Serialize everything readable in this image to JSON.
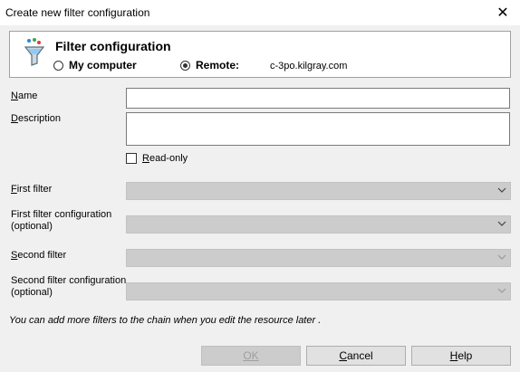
{
  "window": {
    "title": "Create new filter configuration",
    "close_icon": "close-icon"
  },
  "header": {
    "title": "Filter configuration",
    "icon": "funnel-icon",
    "radio_my_computer": "My computer",
    "radio_remote": "Remote:",
    "remote_host": "c-3po.kilgray.com",
    "selected": "remote"
  },
  "form": {
    "name_label": "Name",
    "name_value": "",
    "description_label": "Description",
    "description_value": "",
    "readonly_label": "Read-only",
    "readonly_checked": false,
    "first_filter_label": "First filter",
    "first_filter_value": "",
    "first_filter_config_label_1": "First filter configuration",
    "first_filter_config_label_2": "(optional)",
    "first_filter_config_value": "",
    "second_filter_label": "Second filter",
    "second_filter_value": "",
    "second_filter_config_label_1": "Second filter configuration",
    "second_filter_config_label_2": "(optional)",
    "second_filter_config_value": ""
  },
  "note": "You can add more filters to the chain when you edit the resource later .",
  "buttons": {
    "ok": "OK",
    "cancel": "Cancel",
    "help": "Help"
  },
  "colors": {
    "panel_bg": "#ffffff",
    "dialog_bg": "#f0f0f0",
    "combo_disabled": "#cccccc"
  }
}
